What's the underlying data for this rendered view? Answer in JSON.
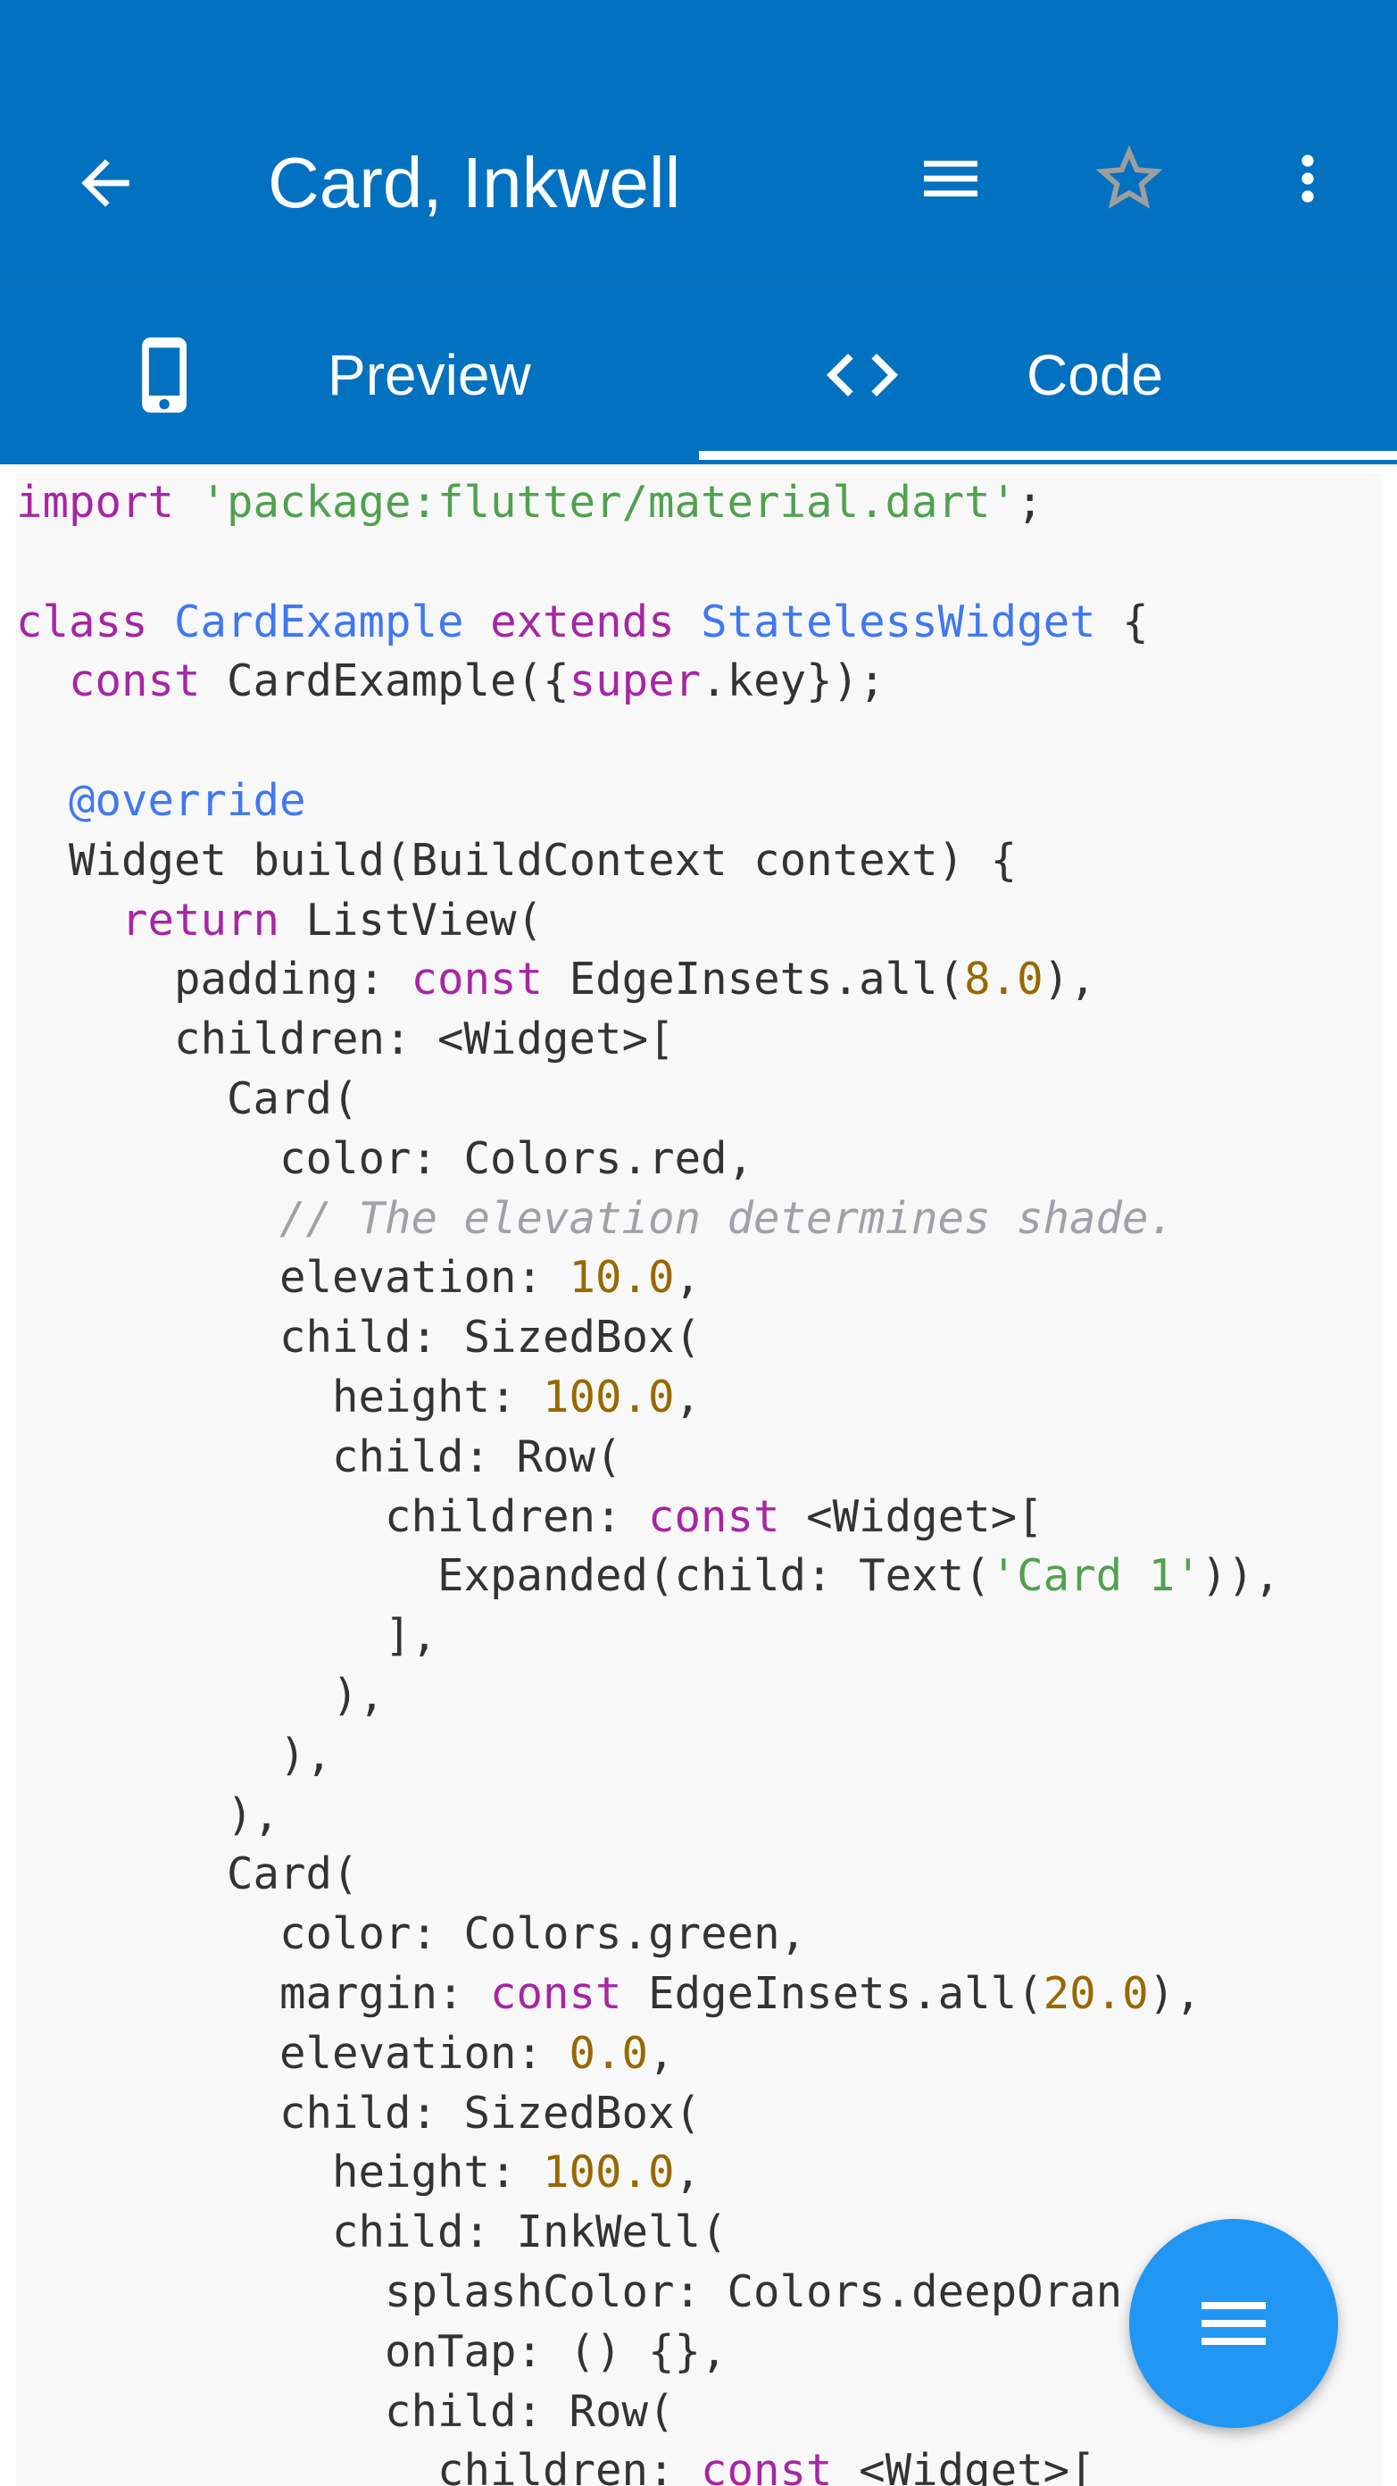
{
  "app": {
    "title": "Card, Inkwell",
    "accent_color": "#0271c0",
    "fab_color": "#2196f3"
  },
  "appbar": {
    "back_icon": "arrow-back-icon",
    "menu_icon": "hamburger-menu-icon",
    "favorite_icon": "star-outline-icon",
    "more_icon": "more-vertical-icon"
  },
  "tabs": [
    {
      "label": "Preview",
      "icon": "phone-icon",
      "selected": false
    },
    {
      "label": "Code",
      "icon": "code-brackets-icon",
      "selected": true
    }
  ],
  "code": {
    "language": "dart",
    "lines": [
      "import 'package:flutter/material.dart';",
      "",
      "class CardExample extends StatelessWidget {",
      "  const CardExample({super.key});",
      "",
      "  @override",
      "  Widget build(BuildContext context) {",
      "    return ListView(",
      "      padding: const EdgeInsets.all(8.0),",
      "      children: <Widget>[",
      "        Card(",
      "          color: Colors.red,",
      "          // The elevation determines shade.",
      "          elevation: 10.0,",
      "          child: SizedBox(",
      "            height: 100.0,",
      "            child: Row(",
      "              children: const <Widget>[",
      "                Expanded(child: Text('Card 1')),",
      "              ],",
      "            ),",
      "          ),",
      "        ),",
      "        Card(",
      "          color: Colors.green,",
      "          margin: const EdgeInsets.all(20.0),",
      "          elevation: 0.0,",
      "          child: SizedBox(",
      "            height: 100.0,",
      "            child: InkWell(",
      "              splashColor: Colors.deepOran",
      "              onTap: () {},",
      "              child: Row(",
      "                children: const <Widget>["
    ]
  },
  "fab": {
    "icon": "hamburger-menu-icon"
  }
}
